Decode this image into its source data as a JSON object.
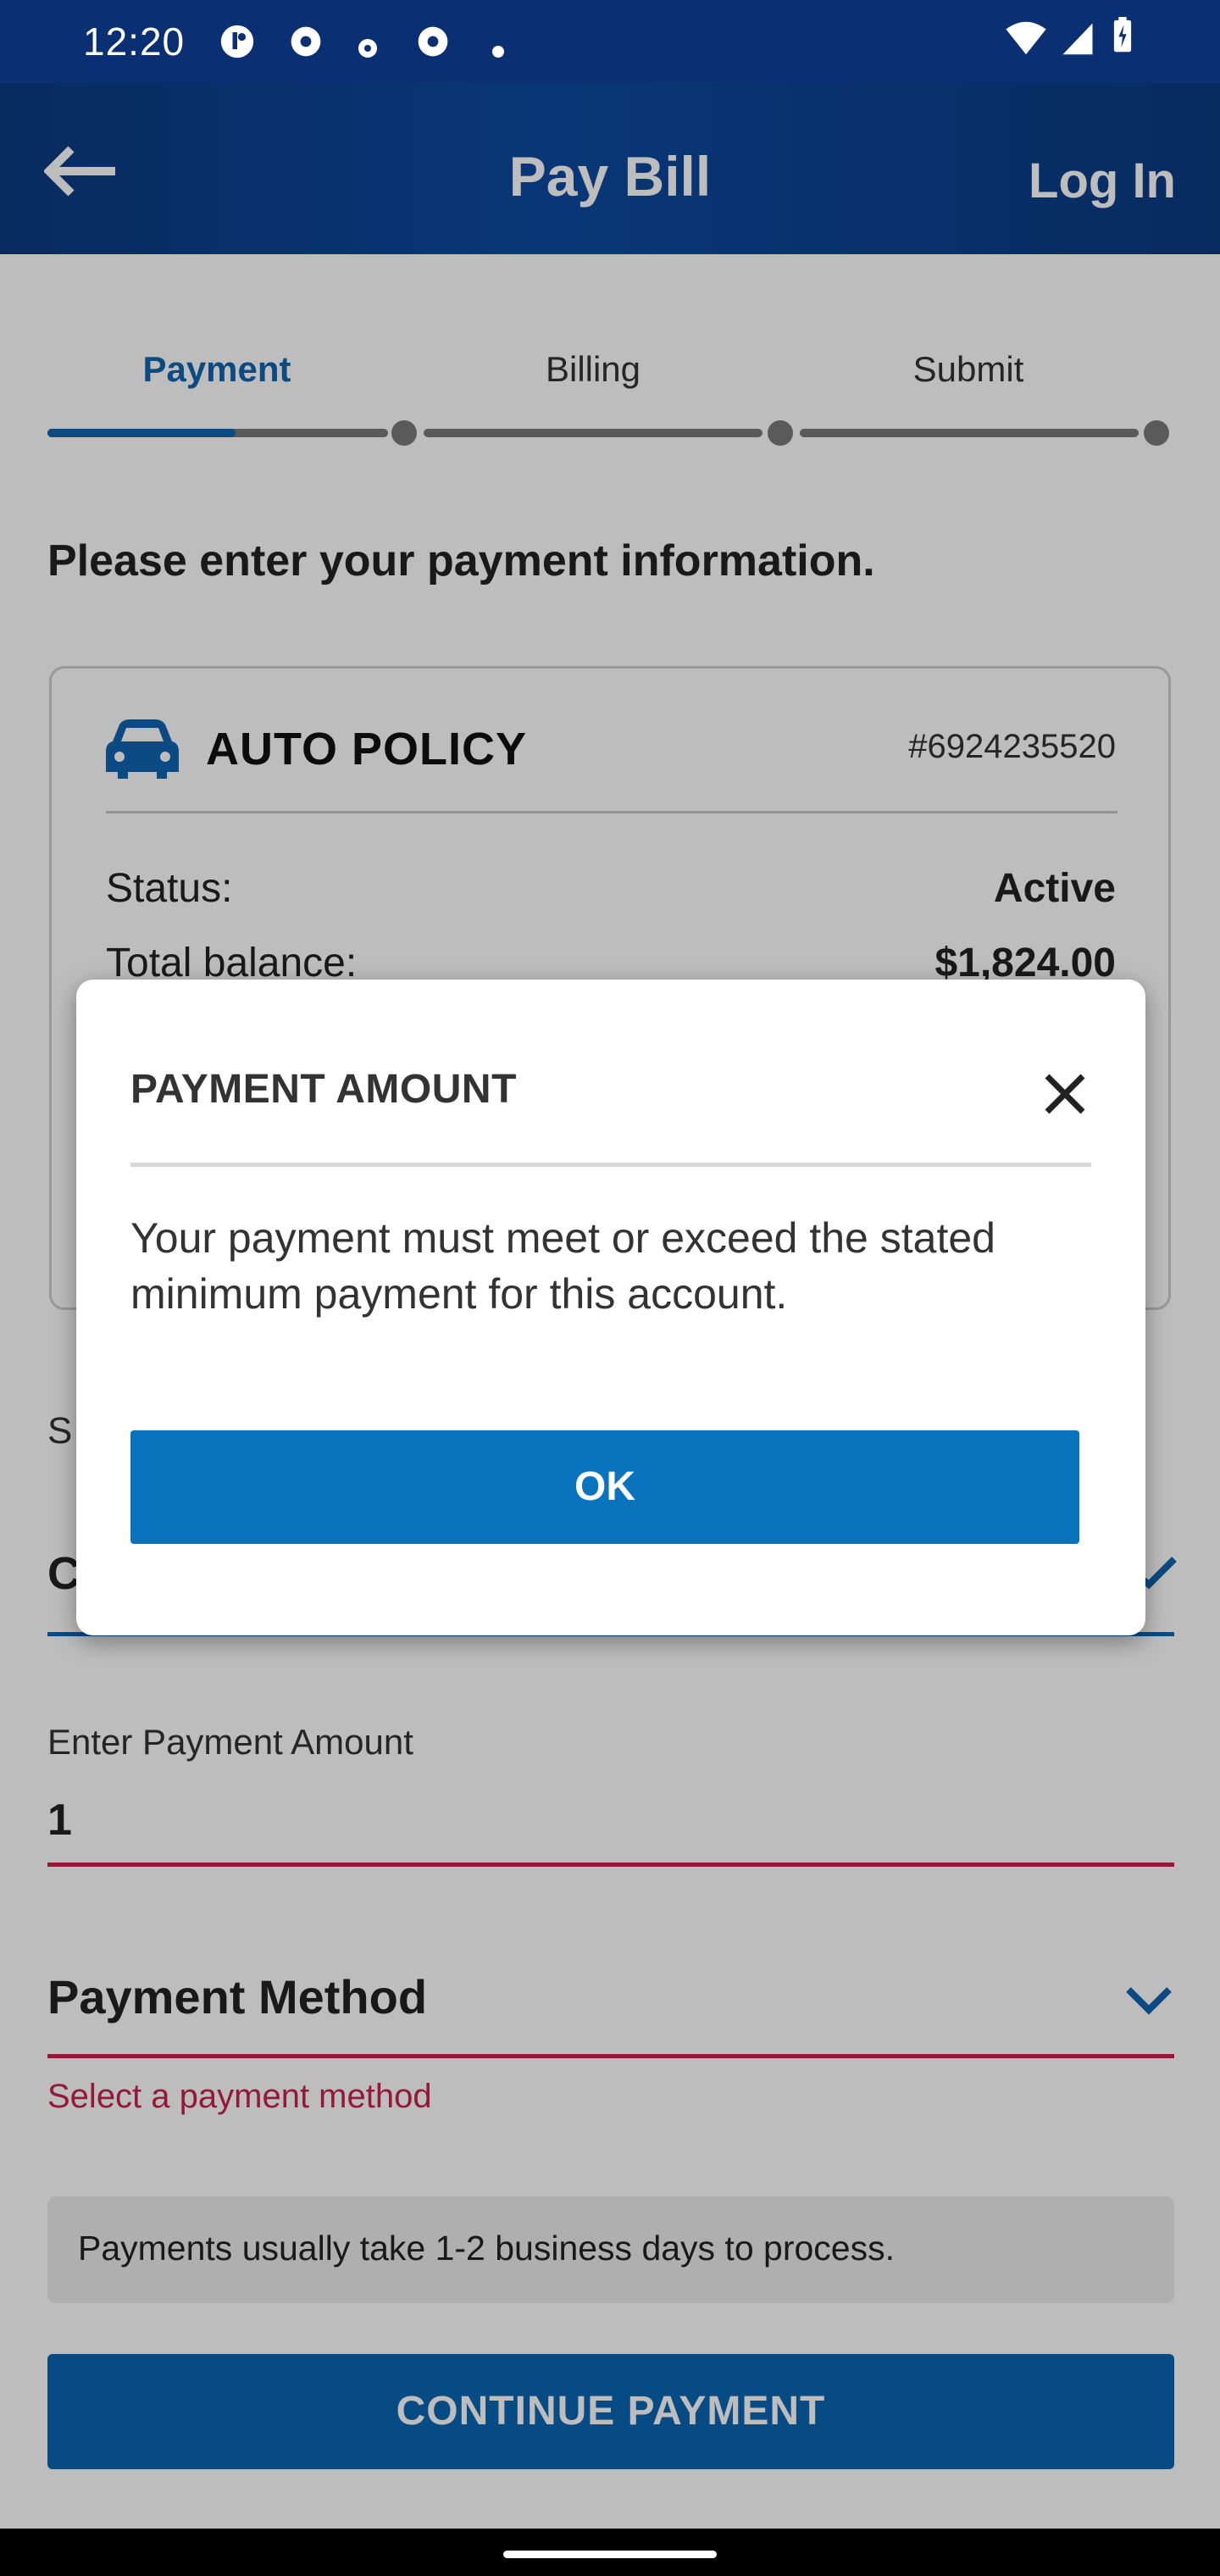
{
  "status_bar": {
    "time": "12:20",
    "icons": [
      "notification-icon",
      "chrome-icon",
      "small-dot-icon",
      "chrome-icon",
      "dot-icon",
      "wifi-icon",
      "signal-icon",
      "battery-icon"
    ]
  },
  "header": {
    "title": "Pay Bill",
    "login_label": "Log In",
    "back_icon": "arrow-left-icon"
  },
  "stepper": {
    "steps": [
      {
        "label": "Payment",
        "active": true
      },
      {
        "label": "Billing",
        "active": false
      },
      {
        "label": "Submit",
        "active": false
      }
    ],
    "progress_fraction": 0.5
  },
  "prompt": "Please enter your payment information.",
  "policy": {
    "icon": "car-icon",
    "title": "AUTO POLICY",
    "number": "#6924235520",
    "status_label": "Status:",
    "status_value": "Active",
    "balance_label": "Total balance:",
    "balance_value": "$1,824.00"
  },
  "amount_select": {
    "label_visible": "S",
    "value_visible": "C"
  },
  "payment_amount": {
    "label": "Enter Payment Amount",
    "value": "1"
  },
  "payment_method": {
    "label": "Payment Method",
    "error": "Select a payment method"
  },
  "processing_note": "Payments usually take 1-2 business days to process.",
  "continue_label": "CONTINUE PAYMENT",
  "modal": {
    "title": "PAYMENT AMOUNT",
    "message": "Your payment must meet or exceed the stated minimum payment for this account.",
    "ok_label": "OK"
  },
  "colors": {
    "brand_blue": "#0a66b4",
    "header_blue": "#0b3b82",
    "error_red": "#c8224e"
  }
}
